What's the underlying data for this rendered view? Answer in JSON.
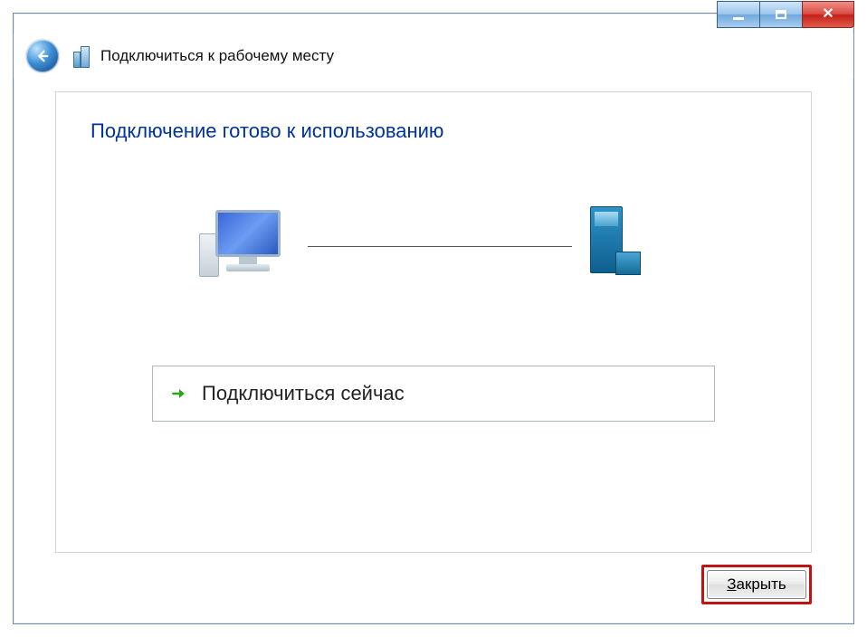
{
  "window": {
    "title": "Подключиться к рабочему месту"
  },
  "content": {
    "heading": "Подключение готово к использованию",
    "connect_now": "Подключиться сейчас",
    "connect_now_mnemonic": "с"
  },
  "buttons": {
    "close_pre": "",
    "close_mnemonic": "З",
    "close_post": "акрыть"
  },
  "icons": {
    "back": "back-icon",
    "window_icon": "connection-icon",
    "minimize": "minimize-icon",
    "maximize": "maximize-icon",
    "close_window": "close-icon",
    "arrow": "go-arrow-icon",
    "client_pc": "client-computer-icon",
    "server": "server-icon"
  }
}
